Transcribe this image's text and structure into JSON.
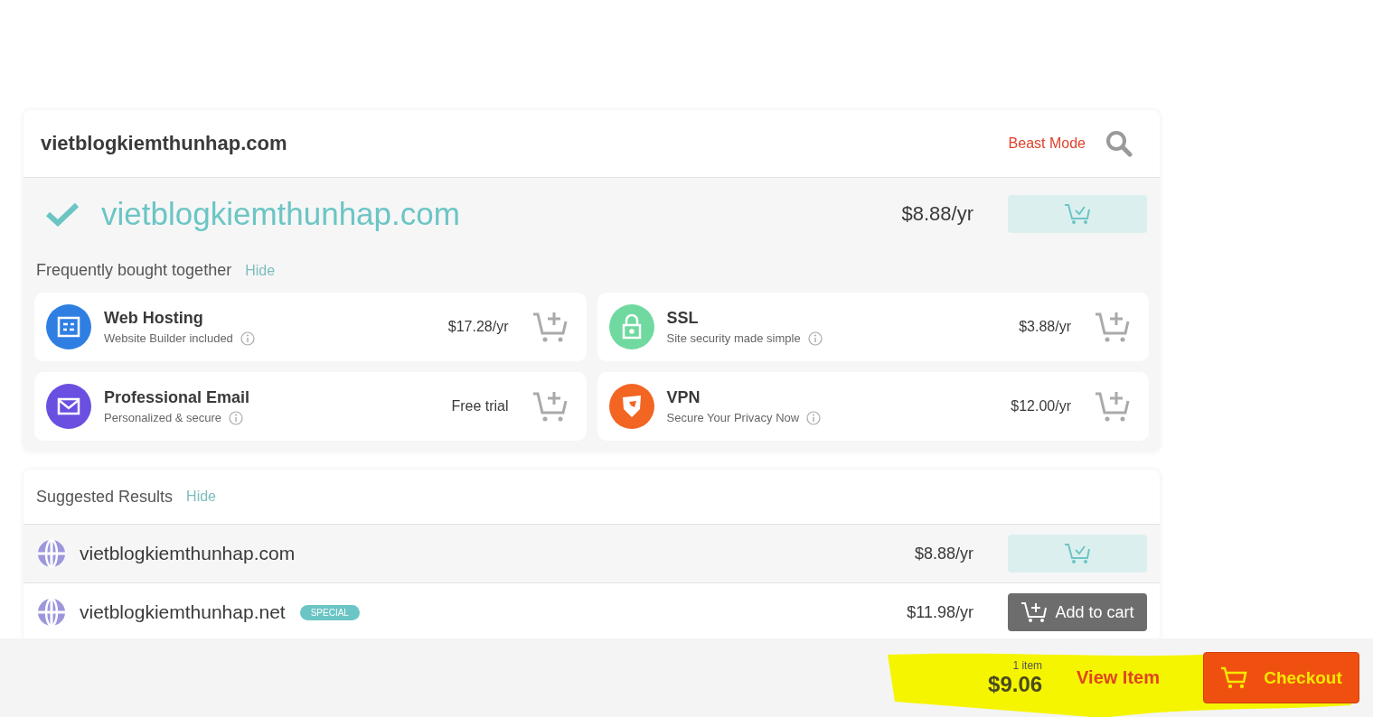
{
  "search": {
    "query": "vietblogkiemthunhap.com",
    "mode_link": "Beast Mode"
  },
  "result": {
    "domain": "vietblogkiemthunhap.com",
    "price": "$8.88/yr",
    "in_cart": true
  },
  "bundle": {
    "title": "Frequently bought together",
    "hide": "Hide",
    "items": [
      {
        "kind": "hosting",
        "name": "Web Hosting",
        "subtitle": "Website Builder included",
        "price": "$17.28/yr",
        "color": "#2f7fe3"
      },
      {
        "kind": "ssl",
        "name": "SSL",
        "subtitle": "Site security made simple",
        "price": "$3.88/yr",
        "color": "#6fd9a0"
      },
      {
        "kind": "email",
        "name": "Professional Email",
        "subtitle": "Personalized & secure",
        "price": "Free trial",
        "color": "#6a4fe0"
      },
      {
        "kind": "vpn",
        "name": "VPN",
        "subtitle": "Secure Your Privacy Now",
        "price": "$12.00/yr",
        "color": "#f26522"
      }
    ]
  },
  "suggested": {
    "title": "Suggested Results",
    "hide": "Hide",
    "rows": [
      {
        "domain": "vietblogkiemthunhap.com",
        "price": "$8.88/yr",
        "in_cart": true
      },
      {
        "domain": "vietblogkiemthunhap.net",
        "badge": "SPECIAL",
        "price": "$11.98/yr",
        "in_cart": false,
        "button": "Add to cart"
      }
    ]
  },
  "cart": {
    "count": "1 item",
    "total": "$9.06",
    "view": "View Item",
    "checkout": "Checkout"
  }
}
